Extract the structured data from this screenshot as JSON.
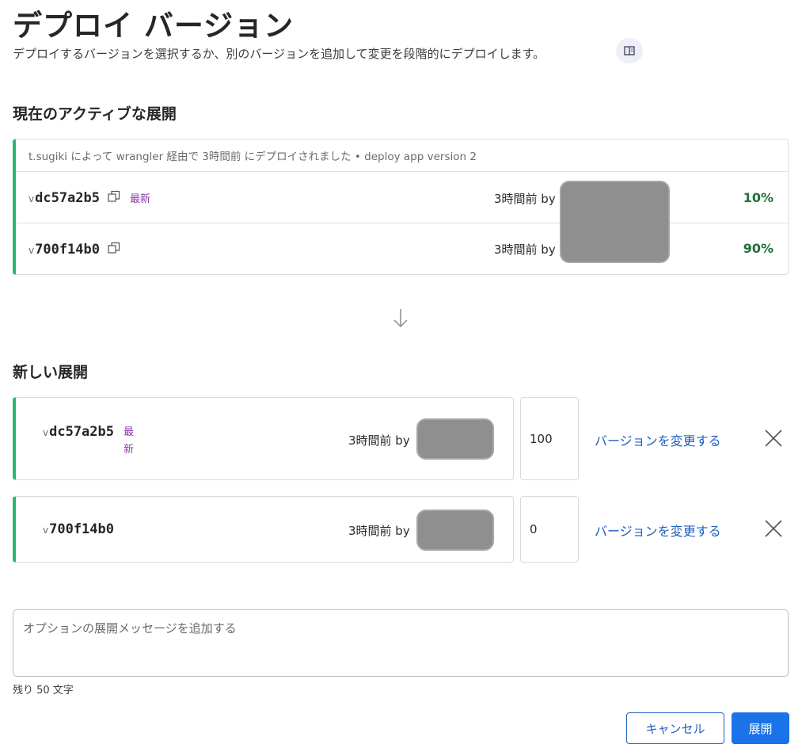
{
  "header": {
    "title": "デプロイ バージョン",
    "subtitle": "デプロイするバージョンを選択するか、別のバージョンを追加して変更を段階的にデプロイします。",
    "docs_icon": "book-icon"
  },
  "current": {
    "section_title": "現在のアクティブな展開",
    "meta": "t.sugiki によって wrangler 経由で 3時間前 にデプロイされました • deploy app version 2",
    "rows": [
      {
        "prefix": "v",
        "version": "dc57a2b5",
        "latest": "最新",
        "time_by": "3時間前 by",
        "percent": "10%"
      },
      {
        "prefix": "v",
        "version": "700f14b0",
        "latest": "",
        "time_by": "3時間前 by",
        "percent": "90%"
      }
    ]
  },
  "new": {
    "section_title": "新しい展開",
    "rows": [
      {
        "prefix": "v",
        "version": "dc57a2b5",
        "latest": "最新",
        "time_by": "3時間前 by",
        "percent": "100",
        "change_label": "バージョンを変更する"
      },
      {
        "prefix": "v",
        "version": "700f14b0",
        "latest": "",
        "time_by": "3時間前 by",
        "percent": "0",
        "change_label": "バージョンを変更する"
      }
    ]
  },
  "message": {
    "placeholder": "オプションの展開メッセージを追加する",
    "remaining": "残り 50 文字"
  },
  "actions": {
    "cancel_label": "キャンセル",
    "deploy_label": "展開"
  },
  "colors": {
    "accent_green": "#2bb673",
    "percent_green": "#1f6f3b",
    "link_blue": "#1f5fbf",
    "primary_blue": "#1a73e8",
    "latest_purple": "#8e3ba7"
  }
}
